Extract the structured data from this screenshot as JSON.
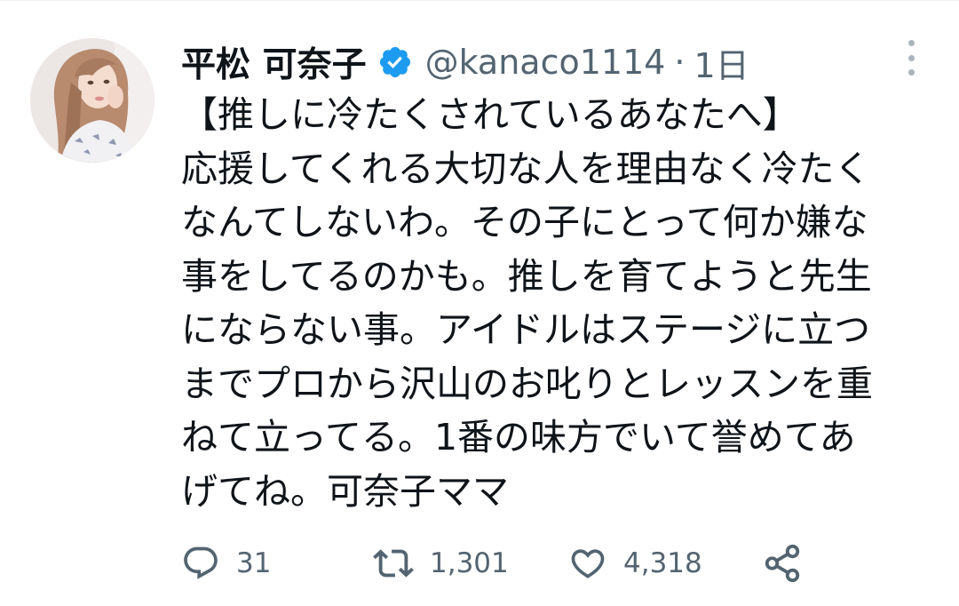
{
  "tweet": {
    "author": {
      "name": "平松 可奈子",
      "handle": "@kanaco1114",
      "separator": "·",
      "time": "1日"
    },
    "body_lines": [
      "【推しに冷たくされているあなたへ】",
      "応援してくれる大切な人を理由なく冷たく",
      "なんてしないわ。その子にとって何か嫌な",
      "事をしてるのかも。推しを育てようと先生",
      "にならない事。アイドルはステージに立つ",
      "までプロから沢山のお叱りとレッスンを重",
      "ねて立ってる。1番の味方でいて誉めてあ",
      "げてね。可奈子ママ"
    ],
    "actions": {
      "reply_count": "31",
      "retweet_count": "1,301",
      "like_count": "4,318"
    }
  },
  "icons": {
    "verified": "verified-badge-icon",
    "more": "more-vertical-icon",
    "reply": "reply-bubble-icon",
    "retweet": "retweet-icon",
    "like": "heart-icon",
    "share": "share-icon"
  },
  "colors": {
    "text": "#0f1419",
    "secondary": "#536471",
    "verified": "#1d9bf0"
  }
}
